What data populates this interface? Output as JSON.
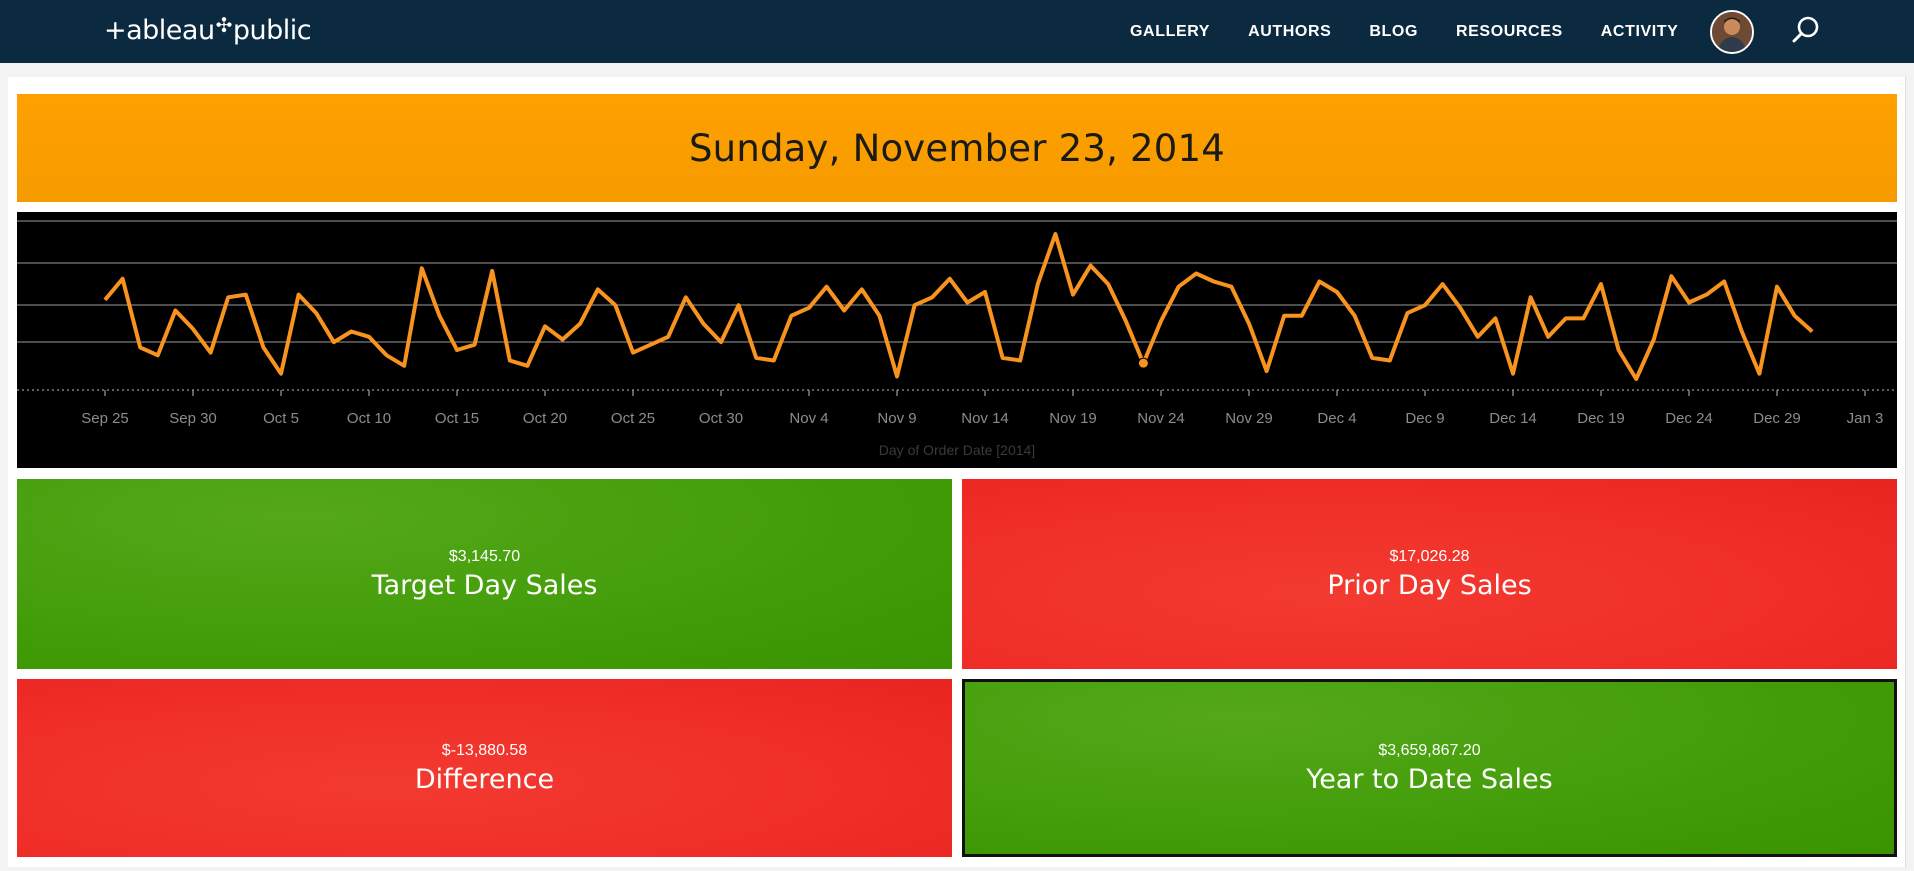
{
  "nav": {
    "logo": "+ableau",
    "logo_tail": "public",
    "links": [
      "GALLERY",
      "AUTHORS",
      "BLOG",
      "RESOURCES",
      "ACTIVITY"
    ],
    "icons": {
      "search": "search-icon",
      "avatar": "avatar"
    }
  },
  "dashboard": {
    "date_title": "Sunday, November 23, 2014",
    "tiles": {
      "target": {
        "value": "$3,145.70",
        "label": "Target Day Sales"
      },
      "prior": {
        "value": "$17,026.28",
        "label": "Prior Day Sales"
      },
      "difference": {
        "value": "$-13,880.58",
        "label": "Difference"
      },
      "ytd": {
        "value": "$3,659,867.20",
        "label": "Year to Date Sales"
      }
    },
    "colors": {
      "banner": "#ffa000",
      "good": "#3f9a05",
      "bad": "#ee2c26",
      "nav_bg": "#0c2a3f",
      "line": "#f7931e"
    }
  },
  "chart_data": {
    "type": "line",
    "xlabel": "Day of Order Date [2014]",
    "x_ticks": [
      "Sep 25",
      "Sep 30",
      "Oct 5",
      "Oct 10",
      "Oct 15",
      "Oct 20",
      "Oct 25",
      "Oct 30",
      "Nov 4",
      "Nov 9",
      "Nov 14",
      "Nov 19",
      "Nov 24",
      "Nov 29",
      "Dec 4",
      "Dec 9",
      "Dec 14",
      "Dec 19",
      "Dec 24",
      "Dec 29",
      "Jan 3"
    ],
    "x_start": "2014-09-25",
    "grid": true,
    "highlight_date": "2014-11-23",
    "series": [
      {
        "values": [
          30,
          38,
          12,
          9,
          26,
          19,
          10,
          31,
          32,
          12,
          2,
          32,
          25,
          14,
          18,
          16,
          9,
          5,
          42,
          24,
          11,
          13,
          41,
          7,
          5,
          20,
          15,
          21,
          34,
          28,
          10,
          13,
          16,
          31,
          21,
          14,
          28,
          8,
          7,
          24,
          27,
          35,
          26,
          34,
          24,
          1,
          28,
          31,
          38,
          29,
          33,
          8,
          7,
          36,
          55,
          32,
          43,
          36,
          22,
          6,
          22,
          35,
          40,
          37,
          35,
          21,
          3,
          24,
          24,
          37,
          33,
          24,
          8,
          7,
          25,
          28,
          36,
          27,
          16,
          23,
          2,
          31,
          16,
          23,
          23,
          36,
          11,
          0,
          15,
          39,
          29,
          32,
          37,
          18,
          2,
          35,
          24,
          18
        ]
      }
    ]
  }
}
